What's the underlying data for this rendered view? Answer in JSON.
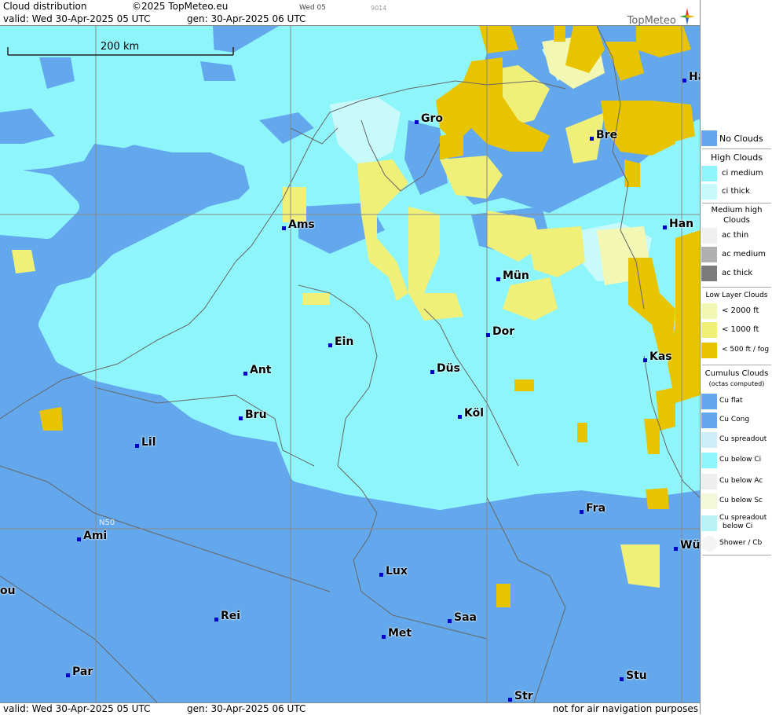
{
  "header": {
    "title": "Cloud distribution",
    "copyright": "©2025 TopMeteo.eu",
    "valid": "valid:  Wed  30-Apr-2025  05 UTC",
    "gen": "gen: 30-Apr-2025 06 UTC",
    "small_label": "Wed 05",
    "tiny_label": "9014",
    "logo": "TopMeteo"
  },
  "map": {
    "scale_label": "200 km",
    "lat_label": "N50",
    "cities": [
      {
        "name": "Gro"
      },
      {
        "name": "Bre"
      },
      {
        "name": "Ha"
      },
      {
        "name": "Ams"
      },
      {
        "name": "Han"
      },
      {
        "name": "Mün"
      },
      {
        "name": "Dor"
      },
      {
        "name": "Ein"
      },
      {
        "name": "Düs"
      },
      {
        "name": "Kas"
      },
      {
        "name": "Ant"
      },
      {
        "name": "Köl"
      },
      {
        "name": "Bru"
      },
      {
        "name": "Lil"
      },
      {
        "name": "Fra"
      },
      {
        "name": "Ami"
      },
      {
        "name": "Wü"
      },
      {
        "name": "Lux"
      },
      {
        "name": "Rei"
      },
      {
        "name": "Saa"
      },
      {
        "name": "Met"
      },
      {
        "name": "ou"
      },
      {
        "name": "Par"
      },
      {
        "name": "Stu"
      },
      {
        "name": "Str"
      }
    ]
  },
  "footer": {
    "valid": "valid:  Wed  30-Apr-2025  05 UTC",
    "gen": "gen: 30-Apr-2025 06 UTC",
    "note": "not for air navigation purposes"
  },
  "legend": {
    "no_clouds": "No Clouds",
    "high_title": "High Clouds",
    "ci_medium": "ci medium",
    "ci_thick": "ci thick",
    "medium_title_1": "Medium high",
    "medium_title_2": "Clouds",
    "ac_thin": "ac thin",
    "ac_medium": "ac medium",
    "ac_thick": "ac thick",
    "low_title": "Low Layer Clouds",
    "low_2000": "< 2000 ft",
    "low_1000": "< 1000 ft",
    "low_500": "< 500 ft / fog",
    "cu_title": "Cumulus Clouds",
    "cu_sub": "(octas computed)",
    "cu_flat": "Cu flat",
    "cu_cong": "Cu Cong",
    "cu_spread": "Cu spreadout",
    "cu_below_ci": "Cu below Ci",
    "cu_below_ac": "Cu below Ac",
    "cu_below_sc": "Cu below Sc",
    "cu_spread_ci_1": "Cu spreadout",
    "cu_spread_ci_2": "below Ci",
    "shower": "Shower / Cb",
    "colors": {
      "no_clouds": "#63a8ec",
      "ci_medium": "#8ef6fa",
      "ci_thick": "#c8fafc",
      "low_2000": "#f2f8b4",
      "low_1000": "#f0f078",
      "low_500": "#e8c400",
      "ac_medium": "#b0b0b0",
      "ac_thick": "#7a7a7a"
    }
  }
}
